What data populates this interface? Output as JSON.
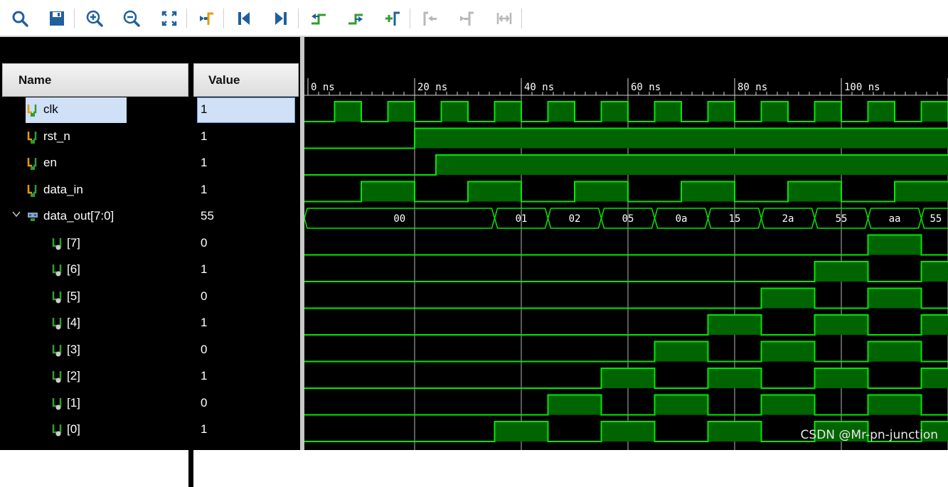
{
  "toolbar": {
    "buttons": [
      {
        "name": "search-icon",
        "enabled": true
      },
      {
        "name": "save-icon",
        "enabled": true
      },
      {
        "name": "zoom-in-icon",
        "enabled": true
      },
      {
        "name": "zoom-out-icon",
        "enabled": true
      },
      {
        "name": "zoom-fit-icon",
        "enabled": true
      },
      {
        "name": "go-to-cursor-icon",
        "enabled": true
      },
      {
        "name": "go-to-time-zero-icon",
        "enabled": true
      },
      {
        "name": "go-to-last-time-icon",
        "enabled": true
      },
      {
        "name": "previous-transition-icon",
        "enabled": true
      },
      {
        "name": "next-transition-icon",
        "enabled": true
      },
      {
        "name": "add-marker-icon",
        "enabled": true
      },
      {
        "name": "previous-marker-icon",
        "enabled": false
      },
      {
        "name": "next-marker-icon",
        "enabled": false
      },
      {
        "name": "swap-cursors-icon",
        "enabled": false
      }
    ],
    "colors": {
      "enabled": "#1f5f9e",
      "accent_green": "#2f9e2f",
      "disabled": "#b8b8b8"
    }
  },
  "headers": {
    "name": "Name",
    "value": "Value"
  },
  "signals": [
    {
      "name": "clk",
      "value": "1",
      "kind": "scalar",
      "selected": true
    },
    {
      "name": "rst_n",
      "value": "1",
      "kind": "scalar"
    },
    {
      "name": "en",
      "value": "1",
      "kind": "scalar"
    },
    {
      "name": "data_in",
      "value": "1",
      "kind": "scalar"
    },
    {
      "name": "data_out[7:0]",
      "value": "55",
      "kind": "bus",
      "expanded": true
    },
    {
      "name": "[7]",
      "value": "0",
      "kind": "bit"
    },
    {
      "name": "[6]",
      "value": "1",
      "kind": "bit"
    },
    {
      "name": "[5]",
      "value": "0",
      "kind": "bit"
    },
    {
      "name": "[4]",
      "value": "1",
      "kind": "bit"
    },
    {
      "name": "[3]",
      "value": "0",
      "kind": "bit"
    },
    {
      "name": "[2]",
      "value": "1",
      "kind": "bit"
    },
    {
      "name": "[1]",
      "value": "0",
      "kind": "bit"
    },
    {
      "name": "[0]",
      "value": "1",
      "kind": "bit"
    }
  ],
  "ruler": {
    "labels": [
      "0 ns",
      "20 ns",
      "40 ns",
      "60 ns",
      "80 ns",
      "100 ns"
    ],
    "unit": "ns",
    "visible_range_ns": [
      0,
      120
    ]
  },
  "waveforms": {
    "clk": {
      "initial": 0,
      "period_ns": 10,
      "first_rise_ns": 5
    },
    "rst_n": {
      "initial": 0,
      "edges_ns": [
        20
      ]
    },
    "en": {
      "initial": 0,
      "edges_ns": [
        24
      ]
    },
    "data_in": {
      "initial": 0,
      "edges_ns": [
        10,
        20,
        30,
        40,
        50,
        60,
        70,
        80,
        90,
        100,
        110
      ]
    },
    "data_out": [
      {
        "t": 0,
        "v": "00"
      },
      {
        "t": 35,
        "v": "01"
      },
      {
        "t": 45,
        "v": "02"
      },
      {
        "t": 55,
        "v": "05"
      },
      {
        "t": 65,
        "v": "0a"
      },
      {
        "t": 75,
        "v": "15"
      },
      {
        "t": 85,
        "v": "2a"
      },
      {
        "t": 95,
        "v": "55"
      },
      {
        "t": 105,
        "v": "aa"
      },
      {
        "t": 115,
        "v": "55"
      }
    ],
    "bits": {
      "7": {
        "initial": 0,
        "edges_ns": [
          105,
          115
        ]
      },
      "6": {
        "initial": 0,
        "edges_ns": [
          95,
          105,
          115
        ]
      },
      "5": {
        "initial": 0,
        "edges_ns": [
          85,
          95,
          105,
          115
        ]
      },
      "4": {
        "initial": 0,
        "edges_ns": [
          75,
          85,
          95,
          105,
          115
        ]
      },
      "3": {
        "initial": 0,
        "edges_ns": [
          65,
          75,
          85,
          95,
          105,
          115
        ]
      },
      "2": {
        "initial": 0,
        "edges_ns": [
          55,
          65,
          75,
          85,
          95,
          105,
          115
        ]
      },
      "1": {
        "initial": 0,
        "edges_ns": [
          45,
          55,
          65,
          75,
          85,
          95,
          105,
          115
        ]
      },
      "0": {
        "initial": 0,
        "edges_ns": [
          35,
          45,
          55,
          65,
          75,
          85,
          95,
          105,
          115
        ]
      }
    }
  },
  "colors": {
    "wave": "#00e800",
    "wave_fill": "#006400",
    "background": "#000000",
    "grid": "#d9d9d9",
    "text": "#ffffff",
    "selection": "#cfe0f7"
  },
  "watermark": "CSDN @Mr-pn-junction"
}
